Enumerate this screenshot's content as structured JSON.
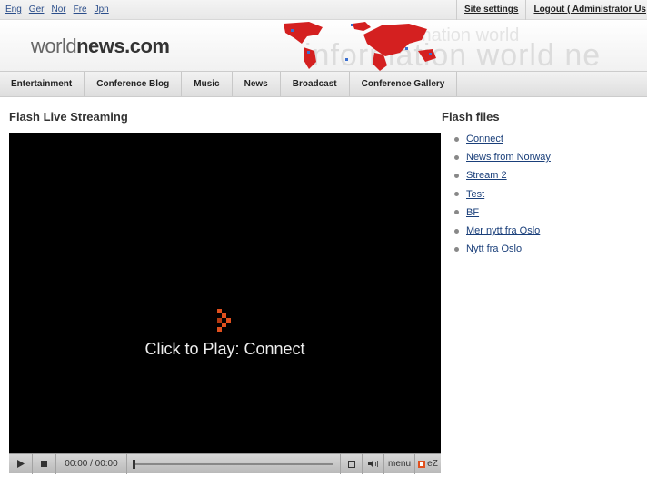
{
  "topbar": {
    "languages": [
      "Eng",
      "Ger",
      "Nor",
      "Fre",
      "Jpn"
    ],
    "site_settings": "Site settings",
    "logout": "Logout ( Administrator Us"
  },
  "header": {
    "logo_light": "world",
    "logo_bold": "news.com",
    "banner_line1": "mation world",
    "banner_line2": "information world ne",
    "map_color": "#d42020"
  },
  "nav": {
    "items": [
      "Entertainment",
      "Conference Blog",
      "Music",
      "News",
      "Broadcast",
      "Conference Gallery"
    ]
  },
  "main": {
    "title": "Flash Live Streaming",
    "player": {
      "overlay_text": "Click to Play: Connect",
      "time": "00:00 / 00:00",
      "menu_label": "menu",
      "ez_label": "eZ",
      "progress": 0,
      "accent": "#e0501e"
    }
  },
  "sidebar": {
    "title": "Flash files",
    "items": [
      "Connect",
      "News from Norway",
      "Stream 2",
      "Test",
      "BF",
      "Mer nytt fra Oslo",
      "Nytt fra Oslo"
    ]
  }
}
